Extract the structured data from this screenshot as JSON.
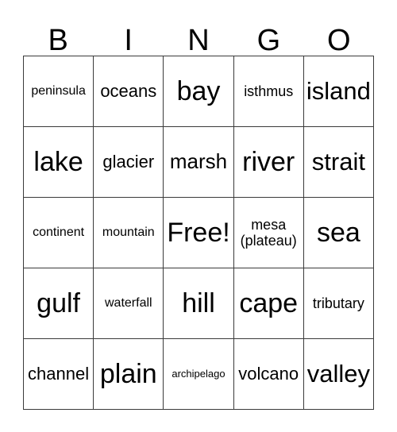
{
  "card": {
    "title": "BINGO",
    "header_letters": [
      "B",
      "I",
      "N",
      "G",
      "O"
    ],
    "free_space_label": "Free!",
    "colors": {
      "background": "#ffffff",
      "text": "#000000",
      "border": "#3a3a3a"
    },
    "grid": {
      "columns": 5,
      "rows": 5,
      "cells": [
        {
          "text": "peninsula",
          "size": "s-sm"
        },
        {
          "text": "oceans",
          "size": "s-lg"
        },
        {
          "text": "bay",
          "size": "s-xxxl"
        },
        {
          "text": "isthmus",
          "size": "s-md"
        },
        {
          "text": "island",
          "size": "s-xxl"
        },
        {
          "text": "lake",
          "size": "s-xxxl"
        },
        {
          "text": "glacier",
          "size": "s-lg"
        },
        {
          "text": "marsh",
          "size": "s-xl"
        },
        {
          "text": "river",
          "size": "s-xxxl"
        },
        {
          "text": "strait",
          "size": "s-xxl"
        },
        {
          "text": "continent",
          "size": "s-sm"
        },
        {
          "text": "mountain",
          "size": "s-sm"
        },
        {
          "text": "Free!",
          "size": "s-xxxl"
        },
        {
          "text": "mesa\n(plateau)",
          "size": "s-md"
        },
        {
          "text": "sea",
          "size": "s-xxxl"
        },
        {
          "text": "gulf",
          "size": "s-xxxl"
        },
        {
          "text": "waterfall",
          "size": "s-sm"
        },
        {
          "text": "hill",
          "size": "s-xxxl"
        },
        {
          "text": "cape",
          "size": "s-xxxl"
        },
        {
          "text": "tributary",
          "size": "s-md"
        },
        {
          "text": "channel",
          "size": "s-lg"
        },
        {
          "text": "plain",
          "size": "s-xxxl"
        },
        {
          "text": "archipelago",
          "size": "s-xs"
        },
        {
          "text": "volcano",
          "size": "s-lg"
        },
        {
          "text": "valley",
          "size": "s-xxl"
        }
      ]
    }
  }
}
